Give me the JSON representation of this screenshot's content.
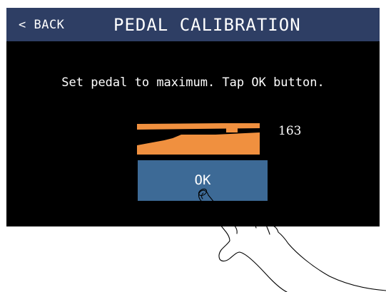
{
  "header": {
    "back_label": "< BACK",
    "title": "PEDAL CALIBRATION"
  },
  "main": {
    "instruction": "Set pedal to maximum. Tap OK button.",
    "pedal_value": "163",
    "ok_label": "OK"
  },
  "icons": {
    "pedal": "pedal-icon",
    "hand": "pointing-hand-illustration"
  },
  "colors": {
    "header_bg": "#2e3e64",
    "screen_bg": "#000000",
    "pedal": "#f0903f",
    "ok_button_bg": "#3d6a96",
    "text": "#ffffff"
  }
}
